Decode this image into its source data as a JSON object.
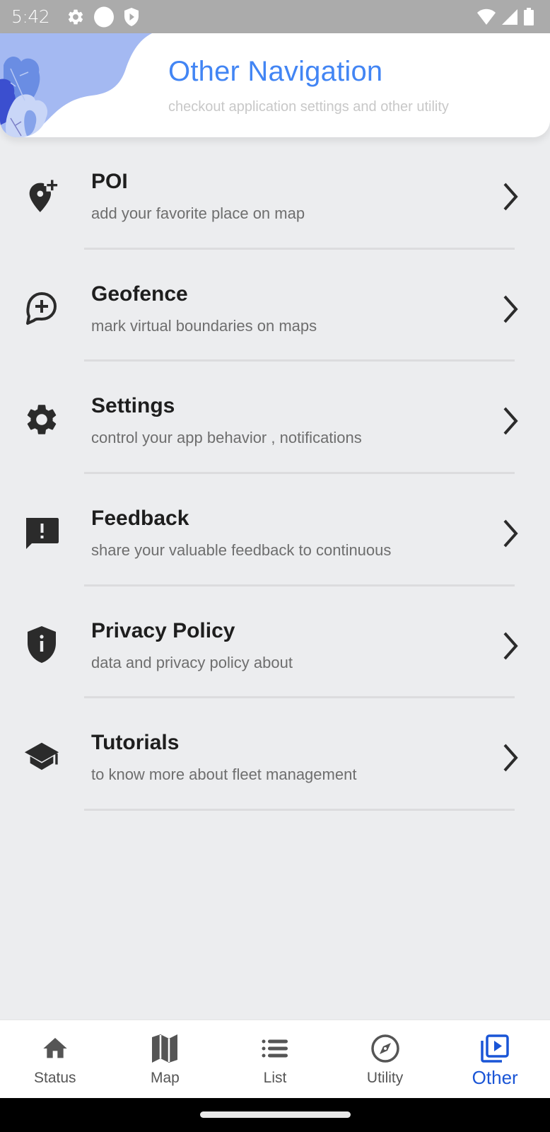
{
  "status_bar": {
    "time": "5:42",
    "left_icons": [
      "gear-icon",
      "circle-icon",
      "shield-play-icon"
    ],
    "right_icons": [
      "wifi-icon",
      "signal-icon",
      "battery-icon"
    ]
  },
  "header": {
    "title": "Other Navigation",
    "subtitle": "checkout application settings and other utility",
    "title_color": "#4285f4"
  },
  "menu": {
    "items": [
      {
        "title": "POI",
        "subtitle": "add your favorite place on map",
        "icon": "add-location-icon"
      },
      {
        "title": "Geofence",
        "subtitle": "mark virtual boundaries on maps",
        "icon": "chat-add-icon"
      },
      {
        "title": "Settings",
        "subtitle": "control your app behavior , notifications",
        "icon": "gear-icon"
      },
      {
        "title": "Feedback",
        "subtitle": "share your valuable feedback to continuous",
        "icon": "feedback-icon"
      },
      {
        "title": "Privacy Policy",
        "subtitle": "data and privacy policy about",
        "icon": "shield-info-icon"
      },
      {
        "title": "Tutorials",
        "subtitle": "to know more about fleet management",
        "icon": "school-icon"
      }
    ]
  },
  "bottom_nav": {
    "items": [
      {
        "label": "Status",
        "icon": "home-icon",
        "active": false
      },
      {
        "label": "Map",
        "icon": "map-icon",
        "active": false
      },
      {
        "label": "List",
        "icon": "list-icon",
        "active": false
      },
      {
        "label": "Utility",
        "icon": "compass-icon",
        "active": false
      },
      {
        "label": "Other",
        "icon": "video-library-icon",
        "active": true
      }
    ],
    "active_color": "#1a55d6"
  }
}
